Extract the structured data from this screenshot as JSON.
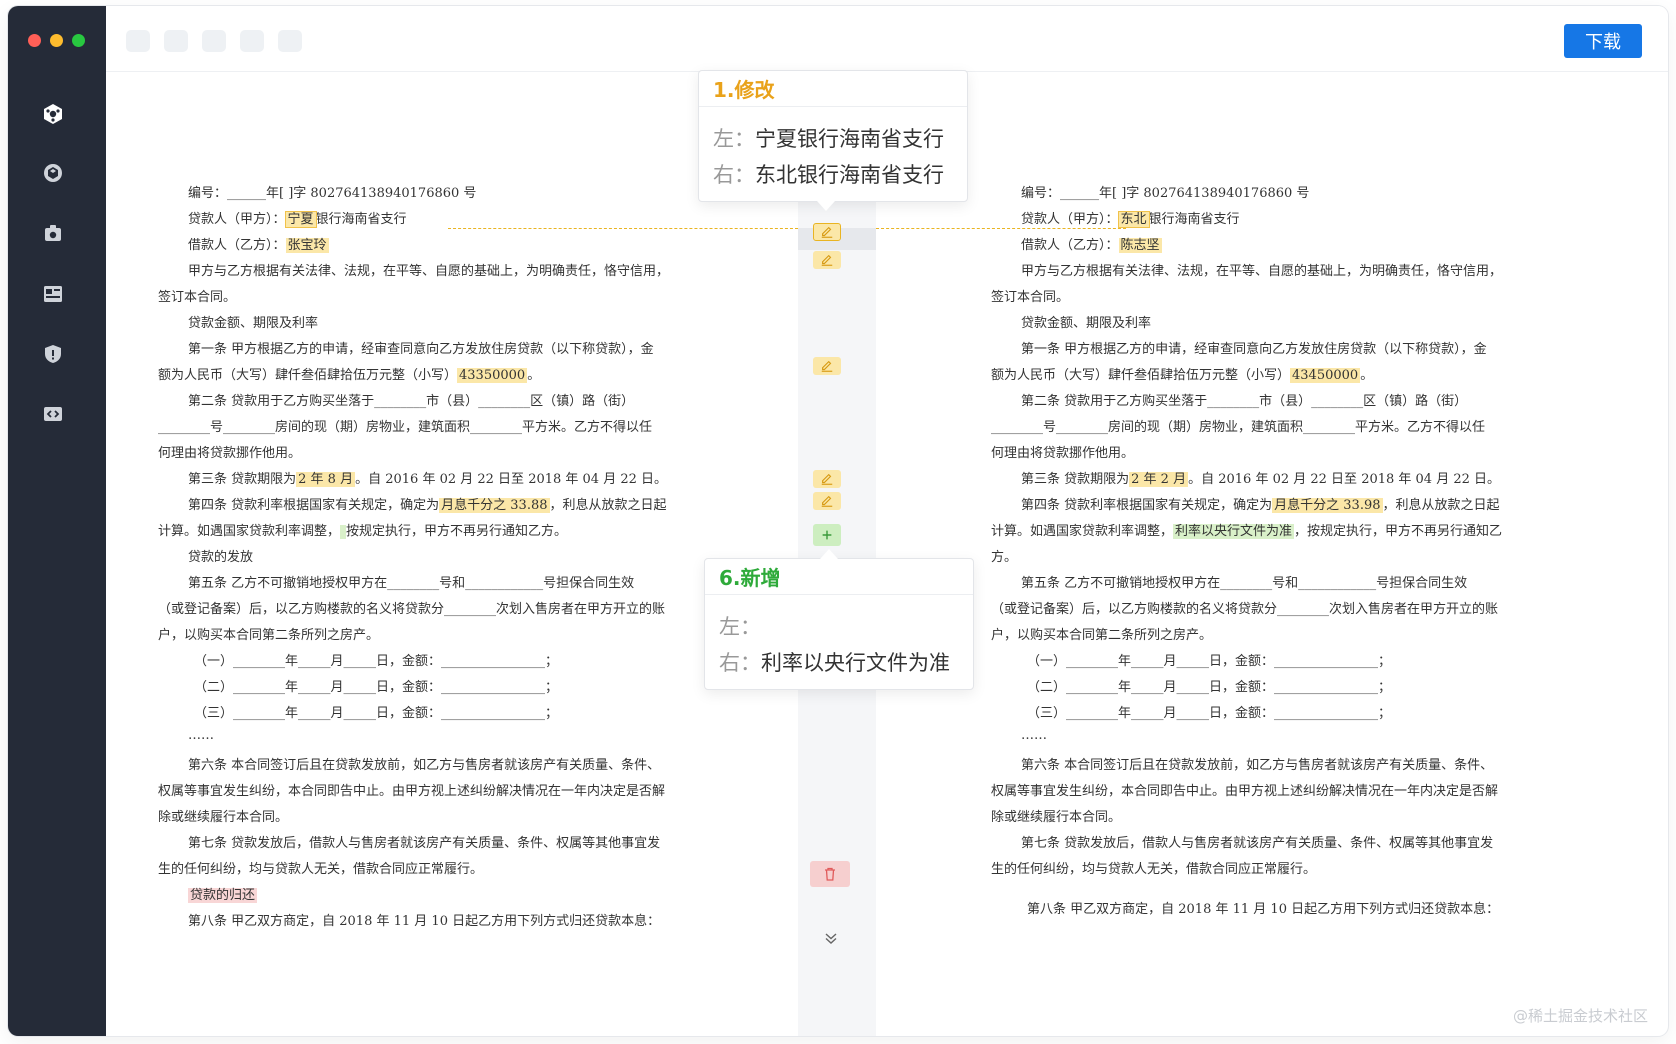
{
  "window": {
    "traffic_colors": [
      "#ff5f57",
      "#febc2e",
      "#28c840"
    ]
  },
  "sidebar": {
    "items": [
      {
        "icon": "logo-icon"
      },
      {
        "icon": "cube-icon"
      },
      {
        "icon": "camera-icon"
      },
      {
        "icon": "layout-icon"
      },
      {
        "icon": "shield-icon"
      },
      {
        "icon": "code-box-icon"
      }
    ]
  },
  "toolbar": {
    "download_label": "下载"
  },
  "left_doc": {
    "l1": "编号：______年[ ]字 802764138940176860 号",
    "l2a": "贷款人（甲方）：",
    "l2hl": "宁夏",
    "l2b": "银行海南省支行",
    "l3a": "借款人（乙方）：",
    "l3hl": "张宝玲",
    "l4": "甲方与乙方根据有关法律、法规，在平等、自愿的基础上，为明确责任，恪守信用，",
    "l5": "签订本合同。",
    "l6": "贷款金额、期限及利率",
    "l7": "第一条  甲方根据乙方的申请，经审查同意向乙方发放住房贷款（以下称贷款），金",
    "l8a": "额为人民币（大写）肆仟叁佰肆拾伍万元整（小写）",
    "l8hl": "43350000",
    "l8b": "。",
    "l9": "第二条  贷款用于乙方购买坐落于________市（县）________区（镇）路（街）",
    "l10": "________号________房间的现（期）房物业，建筑面积________平方米。乙方不得以任",
    "l11": "何理由将贷款挪作他用。",
    "l12a": "第三条  贷款期限为",
    "l12hl": "2 年 8 月",
    "l12b": "。自 2016 年 02 月 22 日至 2018 年 04 月 22 日。",
    "l13a": "第四条  贷款利率根据国家有关规定，确定为",
    "l13hl": "月息千分之 33.88",
    "l13b": "，利息从放款之日起",
    "l14a": "计算。如遇国家贷款利率调整，",
    "l14b": "按规定执行，甲方不再另行通知乙方。",
    "l15": "贷款的发放",
    "l16": "第五条  乙方不可撤销地授权甲方在________号和____________号担保合同生效",
    "l17": "（或登记备案）后，以乙方购楼款的名义将贷款分________次划入售房者在甲方开立的账",
    "l18": "户，以购买本合同第二条所列之房产。",
    "l19": "（一）________年_____月_____日，金额：________________；",
    "l20": "（二）________年_____月_____日，金额：________________；",
    "l21": "（三）________年_____月_____日，金额：________________；",
    "l22": "……",
    "l23": "第六条  本合同签订后且在贷款发放前，如乙方与售房者就该房产有关质量、条件、",
    "l24": "权属等事宜发生纠纷，本合同即告中止。由甲方视上述纠纷解决情况在一年内决定是否解",
    "l25": "除或继续履行本合同。",
    "l26": "第七条  贷款发放后，借款人与售房者就该房产有关质量、条件、权属等其他事宜发",
    "l27": "生的任何纠纷，均与贷款人无关，借款合同应正常履行。",
    "l28hl": "贷款的归还",
    "l29": "第八条  甲乙双方商定，自 2018 年 11 月 10 日起乙方用下列方式归还贷款本息："
  },
  "right_doc": {
    "l1": "编号：______年[ ]字 802764138940176860 号",
    "l2a": "贷款人（甲方）：",
    "l2hl": "东北",
    "l2b": "银行海南省支行",
    "l3a": "借款人（乙方）：",
    "l3hl": "陈志坚",
    "l4": "甲方与乙方根据有关法律、法规，在平等、自愿的基础上，为明确责任，恪守信用，",
    "l5": "签订本合同。",
    "l6": "贷款金额、期限及利率",
    "l7": "第一条  甲方根据乙方的申请，经审查同意向乙方发放住房贷款（以下称贷款），金",
    "l8a": "额为人民币（大写）肆仟叁佰肆拾伍万元整（小写）",
    "l8hl": "43450000",
    "l8b": "。",
    "l9": "第二条  贷款用于乙方购买坐落于________市（县）________区（镇）路（街）",
    "l10": "________号________房间的现（期）房物业，建筑面积________平方米。乙方不得以任",
    "l11": "何理由将贷款挪作他用。",
    "l12a": "第三条  贷款期限为",
    "l12hl": "2 年 2 月",
    "l12b": "。自 2016 年 02 月 22 日至 2018 年 04 月 22 日。",
    "l13a": "第四条  贷款利率根据国家有关规定，确定为",
    "l13hl": "月息千分之 33.98",
    "l13b": "，利息从放款之日起",
    "l14a": "计算。如遇国家贷款利率调整，",
    "l14hl": "利率以央行文件为准",
    "l14b": "，按规定执行，甲方不再另行通知乙",
    "l15": "方。",
    "l16": "第五条  乙方不可撤销地授权甲方在________号和____________号担保合同生效",
    "l17": "（或登记备案）后，以乙方购楼款的名义将贷款分________次划入售房者在甲方开立的账",
    "l18": "户，以购买本合同第二条所列之房产。",
    "l19": "（一）________年_____月_____日，金额：________________；",
    "l20": "（二）________年_____月_____日，金额：________________；",
    "l21": "（三）________年_____月_____日，金额：________________；",
    "l22": "……",
    "l23": "第六条  本合同签订后且在贷款发放前，如乙方与售房者就该房产有关质量、条件、",
    "l24": "权属等事宜发生纠纷，本合同即告中止。由甲方视上述纠纷解决情况在一年内决定是否解",
    "l25": "除或继续履行本合同。",
    "l26": "第七条  贷款发放后，借款人与售房者就该房产有关质量、条件、权属等其他事宜发",
    "l27": "生的任何纠纷，均与贷款人无关，借款合同应正常履行。",
    "l29": "第八条  甲乙双方商定，自 2018 年 11 月 10 日起乙方用下列方式归还贷款本息："
  },
  "popup_modify": {
    "title": "1.修改",
    "title_color": "#e9a21a",
    "left_label": "左：",
    "left_value": "宁夏银行海南省支行",
    "right_label": "右：",
    "right_value": "东北银行海南省支行"
  },
  "popup_add": {
    "title": "6.新增",
    "title_color": "#2eaa3a",
    "left_label": "左：",
    "left_value": "",
    "right_label": "右：",
    "right_value": "利率以央行文件为准"
  },
  "watermark": "@稀土掘金技术社区"
}
